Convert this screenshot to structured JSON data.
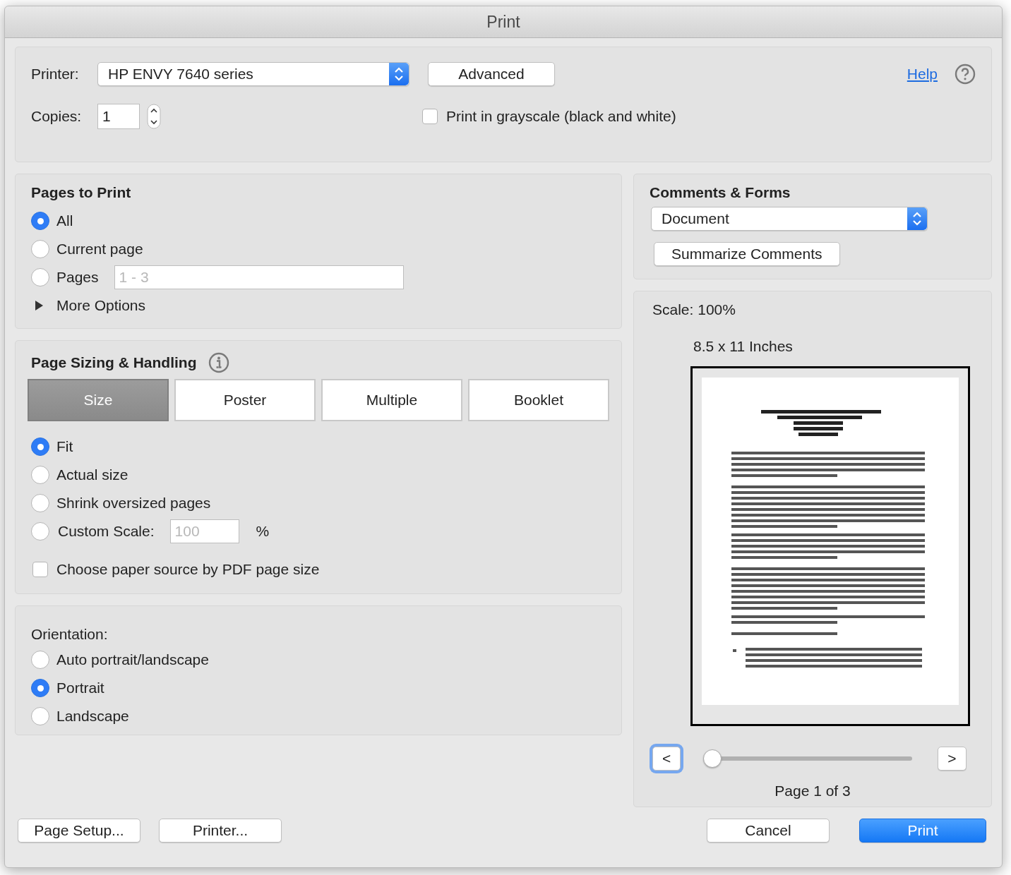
{
  "window": {
    "title": "Print"
  },
  "printer": {
    "label": "Printer:",
    "value": "HP ENVY 7640 series"
  },
  "advanced_button": "Advanced",
  "help_link": "Help",
  "copies": {
    "label": "Copies:",
    "value": "1"
  },
  "grayscale": {
    "label": "Print in grayscale (black and white)",
    "checked": false
  },
  "pages_to_print": {
    "title": "Pages to Print",
    "options": [
      {
        "label": "All",
        "selected": true
      },
      {
        "label": "Current page",
        "selected": false
      },
      {
        "label": "Pages",
        "selected": false,
        "placeholder": "1 - 3"
      }
    ],
    "more_options": {
      "label": "More Options",
      "expanded": false
    }
  },
  "page_sizing": {
    "title": "Page Sizing & Handling",
    "tabs": [
      {
        "label": "Size",
        "selected": true
      },
      {
        "label": "Poster",
        "selected": false
      },
      {
        "label": "Multiple",
        "selected": false
      },
      {
        "label": "Booklet",
        "selected": false
      }
    ],
    "options": [
      {
        "label": "Fit",
        "selected": true
      },
      {
        "label": "Actual size",
        "selected": false
      },
      {
        "label": "Shrink oversized pages",
        "selected": false
      },
      {
        "label": "Custom Scale:",
        "selected": false,
        "placeholder": "100",
        "unit": "%"
      }
    ],
    "paper_source": {
      "label": "Choose paper source by PDF page size",
      "checked": false
    }
  },
  "orientation": {
    "title": "Orientation:",
    "options": [
      {
        "label": "Auto portrait/landscape",
        "selected": false
      },
      {
        "label": "Portrait",
        "selected": true
      },
      {
        "label": "Landscape",
        "selected": false
      }
    ]
  },
  "comments_forms": {
    "title": "Comments & Forms",
    "value": "Document",
    "summarize_button": "Summarize Comments"
  },
  "preview": {
    "scale": "Scale: 100%",
    "paper_size": "8.5 x 11 Inches",
    "prev_button": {
      "label": "<",
      "focused": true
    },
    "next_button": {
      "label": ">",
      "focused": false
    },
    "slider": {
      "level": 0
    },
    "page_label": "Page 1 of 3"
  },
  "buttons": [
    {
      "label": "Page Setup...",
      "kind": "plain"
    },
    {
      "label": "Printer...",
      "kind": "plain"
    },
    {
      "label": "Cancel",
      "kind": "plain"
    },
    {
      "label": "Print",
      "kind": "default"
    }
  ]
}
